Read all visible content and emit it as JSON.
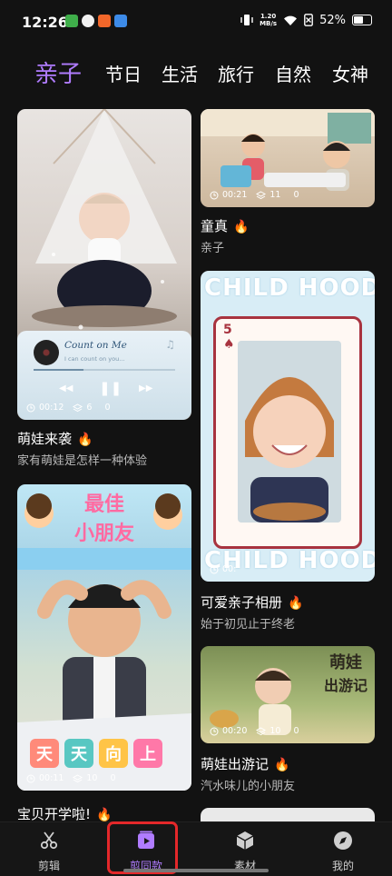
{
  "status_bar": {
    "time": "12:26",
    "net_speed": "1.20",
    "net_unit": "MB/s",
    "battery": "52%"
  },
  "tabs": [
    "亲子",
    "节日",
    "生活",
    "旅行",
    "自然",
    "女神"
  ],
  "feed": {
    "left": [
      {
        "title": "萌娃来袭",
        "subtitle": "家有萌娃是怎样一种体验",
        "player": {
          "song": "Count on Me",
          "lyric": "I can count on you...",
          "time": "00:12"
        },
        "duration": "00:12",
        "clips": "6",
        "likes": "0"
      },
      {
        "title": "宝贝开学啦!",
        "banner_top": "最佳",
        "banner_bottom": "小朋友",
        "chars": [
          "天",
          "天",
          "向",
          "上"
        ],
        "duration": "00:11",
        "clips": "10",
        "likes": "0"
      }
    ],
    "right": [
      {
        "title": "童真",
        "subtitle": "亲子",
        "duration": "00:21",
        "clips": "11",
        "likes": "0"
      },
      {
        "title": "可爱亲子相册",
        "subtitle": "始于初见止于终老",
        "word_top": "CHILD HOOD",
        "word_bottom": "CHILD HOOD",
        "card_rank": "5",
        "duration": "00:",
        "clips": "",
        "likes": ""
      },
      {
        "title": "萌娃出游记",
        "subtitle": "汽水味儿的小朋友",
        "badge_line1": "萌娃",
        "badge_line2": "出游记",
        "duration": "00:20",
        "clips": "10",
        "likes": "0"
      }
    ]
  },
  "nav": [
    {
      "label": "剪辑",
      "icon": "scissors-icon"
    },
    {
      "label": "剪同款",
      "icon": "play-template-icon"
    },
    {
      "label": "素材",
      "icon": "cube-icon"
    },
    {
      "label": "我的",
      "icon": "profile-icon"
    }
  ],
  "colors": {
    "accent": "#b07cff",
    "highlight": "#e4282a",
    "fire": "#ff8a1f"
  }
}
